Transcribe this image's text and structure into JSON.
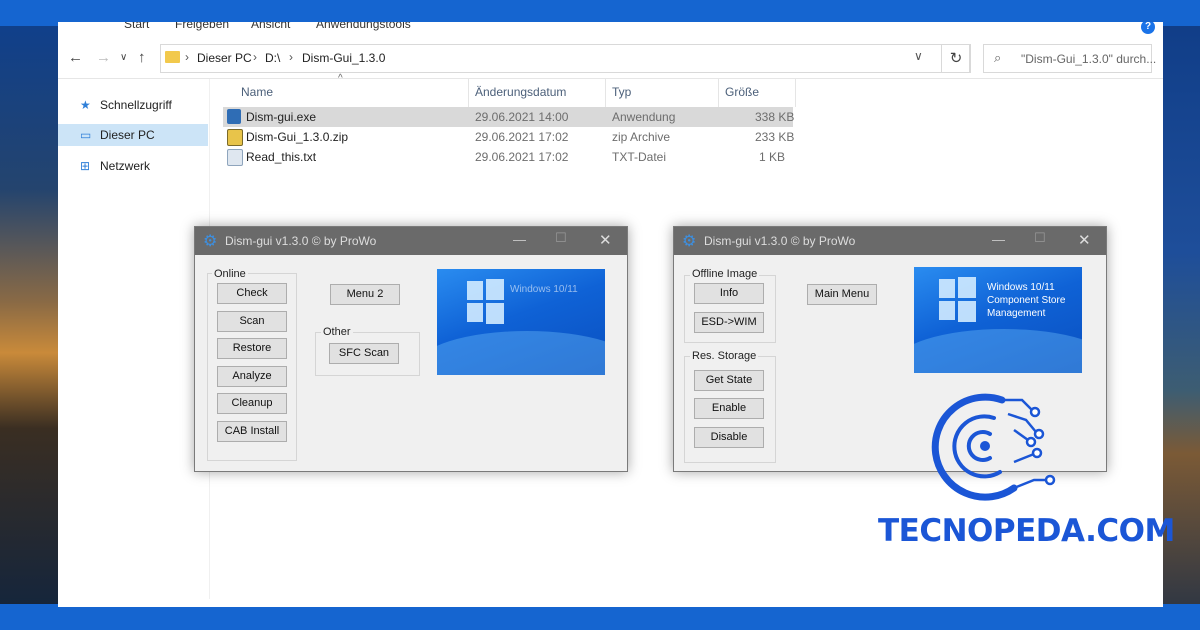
{
  "ribbon": {
    "tabs": [
      "Start",
      "Freigeben",
      "Ansicht",
      "Anwendungstools"
    ],
    "help_icon": "question-icon"
  },
  "address": {
    "crumbs": [
      "Dieser PC",
      "D:\\",
      "Dism-Gui_1.3.0"
    ],
    "search_placeholder": "\"Dism-Gui_1.3.0\" durch..."
  },
  "nav": {
    "items": [
      {
        "label": "Schnellzugriff",
        "icon": "star-icon"
      },
      {
        "label": "Dieser PC",
        "icon": "computer-icon"
      },
      {
        "label": "Netzwerk",
        "icon": "network-icon"
      }
    ]
  },
  "file_list": {
    "columns": [
      "Name",
      "Änderungsdatum",
      "Typ",
      "Größe"
    ],
    "rows": [
      {
        "name": "Dism-gui.exe",
        "date": "29.06.2021 14:00",
        "type": "Anwendung",
        "size": "338 KB"
      },
      {
        "name": "Dism-Gui_1.3.0.zip",
        "date": "29.06.2021 17:02",
        "type": "zip Archive",
        "size": "233 KB"
      },
      {
        "name": "Read_this.txt",
        "date": "29.06.2021 17:02",
        "type": "TXT-Datei",
        "size": "1 KB"
      }
    ]
  },
  "dism1": {
    "title": "Dism-gui v1.3.0     © by ProWo",
    "group_online": "Online",
    "buttons_online": [
      "Check",
      "Scan",
      "Restore",
      "Analyze",
      "Cleanup",
      "CAB Install"
    ],
    "menu2": "Menu 2",
    "group_other": "Other",
    "sfc_scan": "SFC Scan",
    "banner_text": "Windows 10/11"
  },
  "dism2": {
    "title": "Dism-gui v1.3.0     © by ProWo",
    "group_offline": "Offline Image",
    "info": "Info",
    "esd_wim": "ESD->WIM",
    "group_res": "Res. Storage",
    "get_state": "Get State",
    "enable": "Enable",
    "disable": "Disable",
    "main_menu": "Main Menu",
    "banner_text": "Windows 10/11 Component Store Management"
  },
  "brand": {
    "name": "TECNOPEDA.COM",
    "color": "#1b56d6"
  },
  "colors": {
    "selection": "#cce4f7",
    "row_selected": "#d9d9d9",
    "titlebar": "#6a6a6a"
  }
}
